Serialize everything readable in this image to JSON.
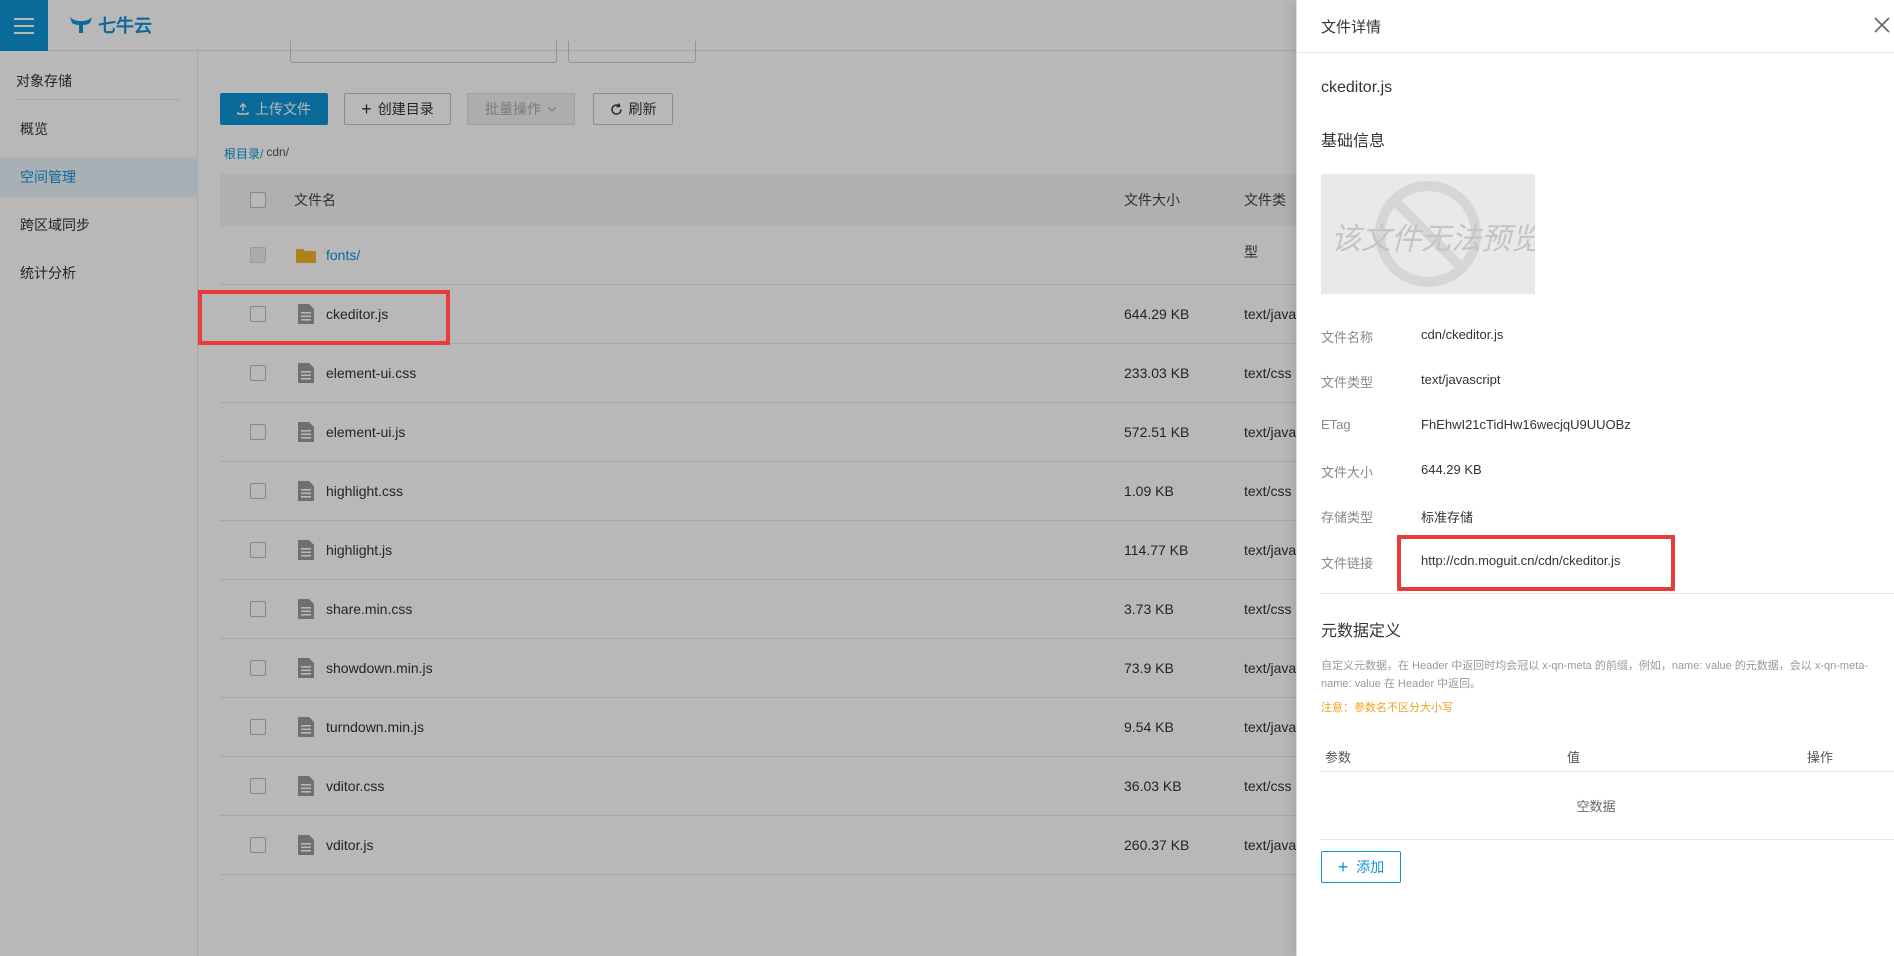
{
  "app": {
    "brand": "七牛云"
  },
  "sidebar": {
    "section_title": "对象存储",
    "items": [
      {
        "label": "概览"
      },
      {
        "label": "空间管理",
        "active": true
      },
      {
        "label": "跨区域同步"
      },
      {
        "label": "统计分析"
      }
    ]
  },
  "toolbar": {
    "upload": "上传文件",
    "mkdir": "创建目录",
    "batch": "批量操作",
    "refresh": "刷新"
  },
  "breadcrumb": {
    "root": "根目录/",
    "current": "cdn/"
  },
  "table": {
    "headers": {
      "name": "文件名",
      "size": "文件大小",
      "type": "文件类型"
    },
    "rows": [
      {
        "name": "fonts/",
        "size": "",
        "type": "",
        "kind": "folder"
      },
      {
        "name": "ckeditor.js",
        "size": "644.29 KB",
        "type": "text/java",
        "kind": "file"
      },
      {
        "name": "element-ui.css",
        "size": "233.03 KB",
        "type": "text/css",
        "kind": "file"
      },
      {
        "name": "element-ui.js",
        "size": "572.51 KB",
        "type": "text/java",
        "kind": "file"
      },
      {
        "name": "highlight.css",
        "size": "1.09 KB",
        "type": "text/css",
        "kind": "file"
      },
      {
        "name": "highlight.js",
        "size": "114.77 KB",
        "type": "text/java",
        "kind": "file"
      },
      {
        "name": "share.min.css",
        "size": "3.73 KB",
        "type": "text/css",
        "kind": "file"
      },
      {
        "name": "showdown.min.js",
        "size": "73.9 KB",
        "type": "text/java",
        "kind": "file"
      },
      {
        "name": "turndown.min.js",
        "size": "9.54 KB",
        "type": "text/java",
        "kind": "file"
      },
      {
        "name": "vditor.css",
        "size": "36.03 KB",
        "type": "text/css",
        "kind": "file"
      },
      {
        "name": "vditor.js",
        "size": "260.37 KB",
        "type": "text/java",
        "kind": "file"
      }
    ]
  },
  "drawer": {
    "title": "文件详情",
    "file_name": "ckeditor.js",
    "basic_info": "基础信息",
    "preview_text": "该文件无法预览",
    "fields": [
      {
        "label": "文件名称",
        "value": "cdn/ckeditor.js"
      },
      {
        "label": "文件类型",
        "value": "text/javascript"
      },
      {
        "label": "ETag",
        "value": "FhEhwI21cTidHw16wecjqU9UUOBz"
      },
      {
        "label": "文件大小",
        "value": "644.29 KB"
      },
      {
        "label": "存储类型",
        "value": "标准存储"
      },
      {
        "label": "文件链接",
        "value": "http://cdn.moguit.cn/cdn/ckeditor.js"
      }
    ],
    "meta_title": "元数据定义",
    "meta_desc": "自定义元数据，在 Header 中返回时均会冠以 x-qn-meta 的前缀，例如，name: value 的元数据，会以 x-qn-meta-name: value 在 Header 中返回。",
    "meta_note": "注意：参数名不区分大小写",
    "meta_headers": {
      "param": "参数",
      "value": "值",
      "action": "操作"
    },
    "empty": "空数据",
    "add": "添加"
  },
  "colors": {
    "accent": "#0f93d6",
    "highlight": "#e93b3b",
    "warning": "#f0a020"
  }
}
